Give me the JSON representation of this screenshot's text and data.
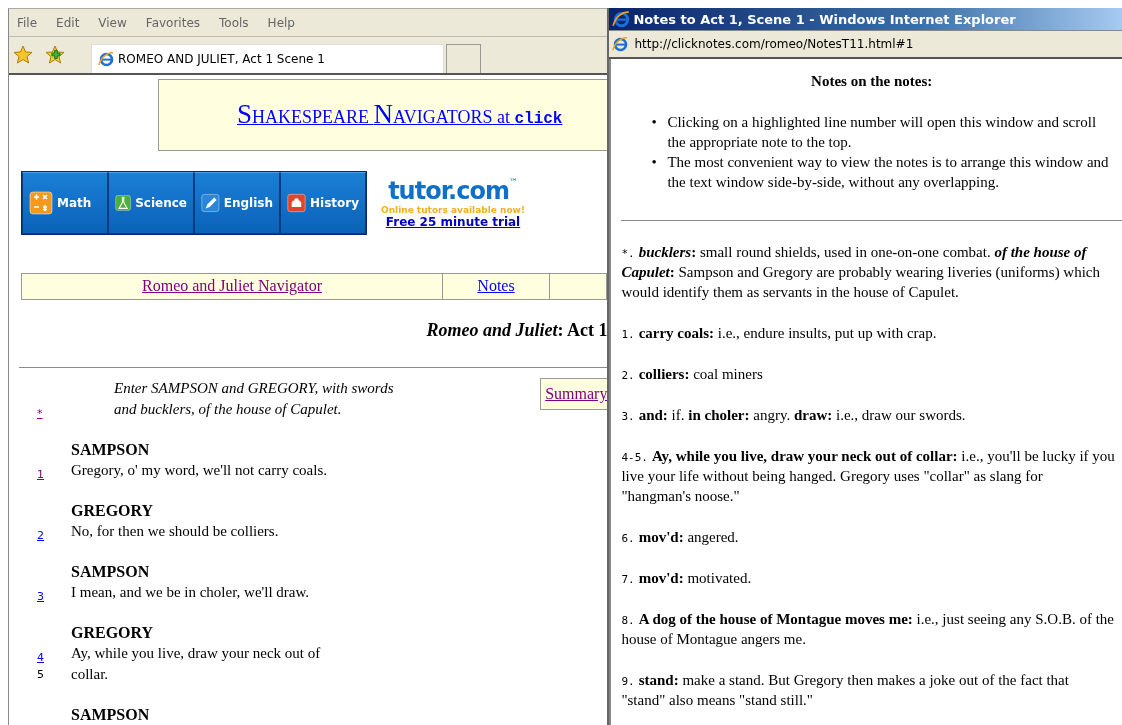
{
  "main_window": {
    "menu": [
      "File",
      "Edit",
      "View",
      "Favorites",
      "Tools",
      "Help"
    ],
    "tab": {
      "title": "ROMEO AND JULIET, Act 1 Scene 1"
    },
    "banner": {
      "title_words": [
        "SHAKESPEARE",
        "NAVIGATORS"
      ],
      "at": "at",
      "site": "click"
    },
    "subject_buttons": [
      {
        "label": "Math",
        "kind": "math"
      },
      {
        "label": "Science",
        "kind": "science"
      },
      {
        "label": "English",
        "kind": "english"
      },
      {
        "label": "History",
        "kind": "history"
      }
    ],
    "ad": {
      "brand": "tutor.com",
      "trademark": "™",
      "tagline": "Online tutors available now!",
      "link": "Free 25 minute trial"
    },
    "nav_links": [
      {
        "label": "Romeo and Juliet Navigator",
        "visited": true
      },
      {
        "label": "Notes",
        "visited": false
      }
    ],
    "heading": "*Romeo and Juliet*: Act 1",
    "summary_link": "Summary",
    "script": [
      {
        "kind": "direction",
        "number": "*",
        "visited": true,
        "lines": [
          "Enter SAMPSON and GREGORY, with swords",
          "and bucklers, of the house of Capulet."
        ]
      },
      {
        "kind": "speech",
        "speaker": "SAMPSON",
        "lines": [
          {
            "number": "1",
            "link": true,
            "visited": true,
            "text": "Gregory, o' my word, we'll not carry coals."
          }
        ]
      },
      {
        "kind": "speech",
        "speaker": "GREGORY",
        "lines": [
          {
            "number": "2",
            "link": true,
            "visited": false,
            "text": "No, for then we should be colliers."
          }
        ]
      },
      {
        "kind": "speech",
        "speaker": "SAMPSON",
        "lines": [
          {
            "number": "3",
            "link": true,
            "visited": false,
            "text": "I mean, and we be in choler, we'll draw."
          }
        ]
      },
      {
        "kind": "speech",
        "speaker": "GREGORY",
        "lines": [
          {
            "number": "4",
            "link": true,
            "visited": false,
            "text": "Ay, while you live, draw your neck out of"
          },
          {
            "number": "5",
            "link": false,
            "text": "collar."
          }
        ]
      },
      {
        "kind": "speech",
        "speaker": "SAMPSON"
      }
    ]
  },
  "notes_window": {
    "title": "Notes to Act 1, Scene 1 - Windows Internet Explorer",
    "address": "http://clicknotes.com/romeo/NotesT11.html#1",
    "heading": "Notes on the notes:",
    "tip_marker": "•",
    "tips": [
      "Clicking on a highlighted line number will open this window and scroll the appropriate note to the top.",
      "The most convenient way to view the notes is to arrange this window and the text window side-by-side, without any overlapping."
    ],
    "notes": [
      {
        "number": "*.",
        "segments": [
          {
            "kind": "term_italic",
            "text": "bucklers"
          },
          {
            "kind": "term",
            "text": ": "
          },
          {
            "kind": "plain",
            "text": "small round shields, used in one-on-one combat. "
          },
          {
            "kind": "term_italic",
            "text": "of the house of Capulet"
          },
          {
            "kind": "term",
            "text": ": "
          },
          {
            "kind": "plain",
            "text": "Sampson and Gregory are probably wearing liveries (uniforms) which would identify them as servants in the house of Capulet."
          }
        ]
      },
      {
        "number": "1.",
        "segments": [
          {
            "kind": "term",
            "text": "carry coals: "
          },
          {
            "kind": "plain",
            "text": "i.e., endure insults, put up with crap."
          }
        ]
      },
      {
        "number": "2.",
        "segments": [
          {
            "kind": "term",
            "text": "colliers: "
          },
          {
            "kind": "plain",
            "text": "coal miners"
          }
        ]
      },
      {
        "number": "3.",
        "segments": [
          {
            "kind": "term",
            "text": "and: "
          },
          {
            "kind": "plain",
            "text": "if. "
          },
          {
            "kind": "term",
            "text": "in choler: "
          },
          {
            "kind": "plain",
            "text": "angry. "
          },
          {
            "kind": "term",
            "text": "draw: "
          },
          {
            "kind": "plain",
            "text": "i.e., draw our swords."
          }
        ]
      },
      {
        "number": "4-5.",
        "segments": [
          {
            "kind": "term",
            "text": "Ay, while you live, draw your neck out of collar: "
          },
          {
            "kind": "plain",
            "text": "i.e., you'll be lucky if you live your life without being hanged. Gregory uses \"collar\" as slang for \"hangman's noose.\""
          }
        ]
      },
      {
        "number": "6.",
        "segments": [
          {
            "kind": "term",
            "text": "mov'd: "
          },
          {
            "kind": "plain",
            "text": "angered."
          }
        ]
      },
      {
        "number": "7.",
        "segments": [
          {
            "kind": "term",
            "text": "mov'd: "
          },
          {
            "kind": "plain",
            "text": "motivated."
          }
        ]
      },
      {
        "number": "8.",
        "segments": [
          {
            "kind": "term",
            "text": "A dog of the house of Montague moves me: "
          },
          {
            "kind": "plain",
            "text": "i.e., just seeing any S.O.B. of the house of Montague angers me."
          }
        ]
      },
      {
        "number": "9.",
        "segments": [
          {
            "kind": "term",
            "text": "stand: "
          },
          {
            "kind": "plain",
            "text": "make a stand. But Gregory then makes a joke out of the fact that \"stand\" also means \"stand still.\""
          }
        ]
      }
    ]
  }
}
